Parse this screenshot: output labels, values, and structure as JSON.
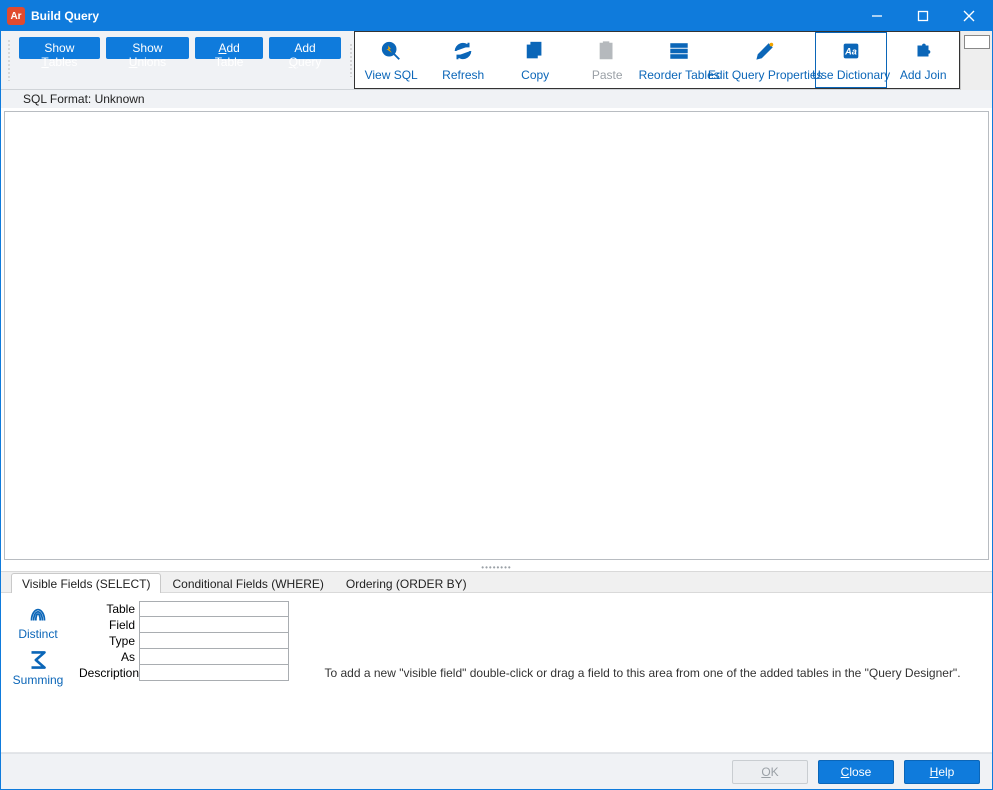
{
  "window": {
    "app_badge": "Ar",
    "title": "Build Query"
  },
  "toolbar": {
    "show_tables_pre": "Show ",
    "show_tables_key": "T",
    "show_tables_post": "ables",
    "show_unions_pre": "Show ",
    "show_unions_key": "U",
    "show_unions_post": "nions",
    "add_table_pre": "",
    "add_table_key": "A",
    "add_table_post": "dd Table",
    "add_query_pre": "Add ",
    "add_query_key": "Q",
    "add_query_post": "uery"
  },
  "status": {
    "sql_format": "SQL Format: Unknown"
  },
  "ribbon": {
    "view_sql": "View SQL",
    "refresh": "Refresh",
    "copy": "Copy",
    "paste": "Paste",
    "reorder_tables": "Reorder Tables",
    "edit_props": "Edit Query Properties",
    "use_dictionary": "Use Dictionary",
    "add_join": "Add Join"
  },
  "tabs": {
    "select": "Visible Fields (SELECT)",
    "where": "Conditional Fields (WHERE)",
    "orderby": "Ordering (ORDER BY)"
  },
  "sidetools": {
    "distinct": "Distinct",
    "summing": "Summing"
  },
  "props": {
    "table": "Table",
    "field": "Field",
    "type": "Type",
    "as": "As",
    "description": "Description"
  },
  "hint": "To add a new \"visible field\" double-click or drag a field to this area from one of the added tables in the \"Query Designer\".",
  "footer": {
    "ok_key": "O",
    "ok_post": "K",
    "close_key": "C",
    "close_post": "lose",
    "help_key": "H",
    "help_post": "elp"
  }
}
